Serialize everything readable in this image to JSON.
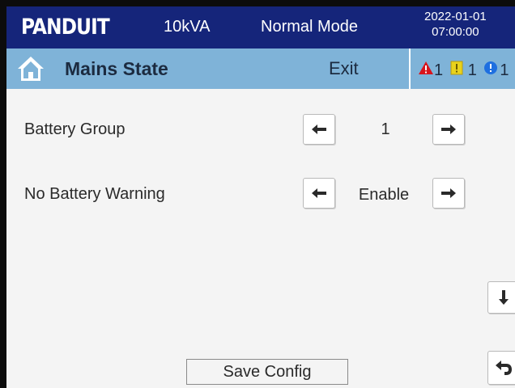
{
  "header": {
    "brand": "PANDUIT",
    "rating": "10kVA",
    "mode": "Normal Mode",
    "date": "2022-01-01",
    "time": "07:00:00",
    "background_color": "#15257a"
  },
  "navbar": {
    "title": "Mains State",
    "exit_label": "Exit",
    "background_color": "#7fb3d8",
    "alarms": [
      {
        "icon": "warning-triangle-icon",
        "count": "1",
        "color": "#d8141c"
      },
      {
        "icon": "exclamation-square-icon",
        "count": "1",
        "color": "#e9d21c"
      },
      {
        "icon": "info-circle-icon",
        "count": "1",
        "color": "#1e6fe0"
      }
    ]
  },
  "settings": [
    {
      "label": "Battery Group",
      "value": "1"
    },
    {
      "label": "No Battery Warning",
      "value": "Enable"
    }
  ],
  "actions": {
    "save_label": "Save Config",
    "scroll_down_icon": "arrow-down-icon",
    "back_icon": "return-arrow-icon"
  }
}
